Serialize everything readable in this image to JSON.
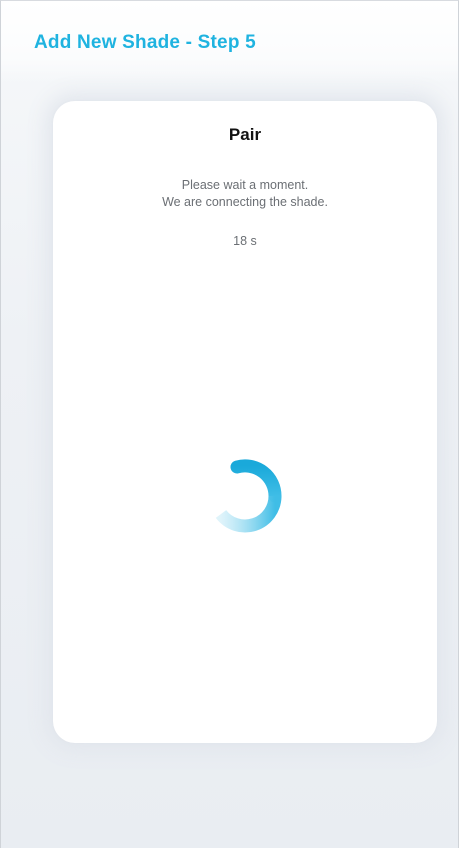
{
  "header": {
    "title": "Add New Shade - Step 5"
  },
  "card": {
    "title": "Pair",
    "message_line1": "Please wait a moment.",
    "message_line2": "We are connecting the shade.",
    "timer": "18 s"
  },
  "spinner": {
    "icon": "loading-spinner-icon",
    "color": "#1fb3e0"
  },
  "colors": {
    "accent": "#1fb3e0",
    "background": "#eef1f5",
    "card": "#ffffff"
  }
}
